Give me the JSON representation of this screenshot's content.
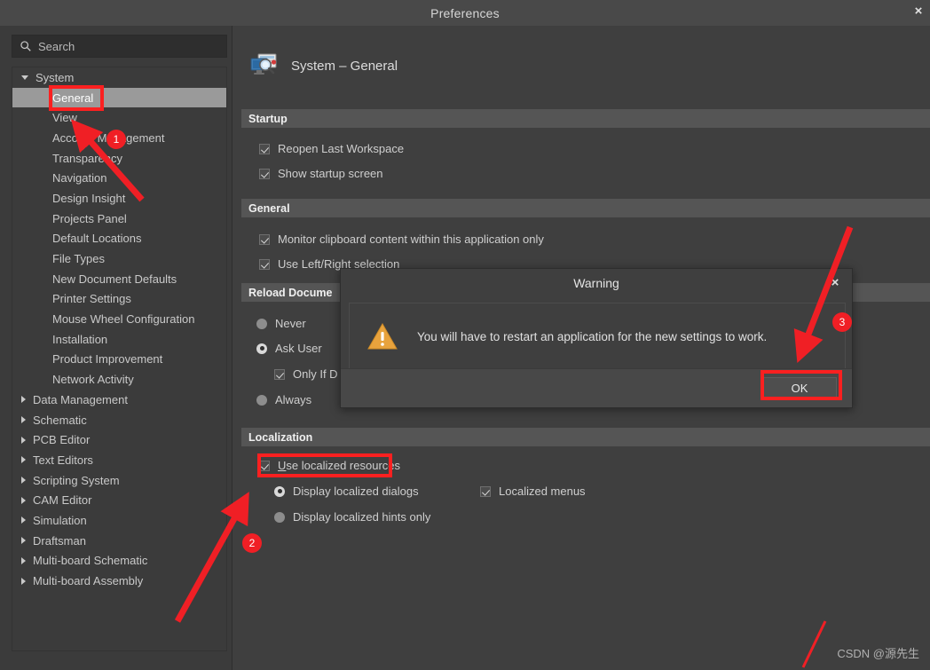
{
  "window": {
    "title": "Preferences",
    "close_label": "×"
  },
  "sidebar": {
    "search": {
      "placeholder": "Search",
      "value": "",
      "icon": "search-icon"
    },
    "tree": [
      {
        "label": "System",
        "level": "root",
        "state": "expanded",
        "selected": false
      },
      {
        "label": "General",
        "level": "child",
        "state": "leaf",
        "selected": true
      },
      {
        "label": "View",
        "level": "child",
        "state": "leaf",
        "selected": false
      },
      {
        "label": "Account Management",
        "level": "child",
        "state": "leaf",
        "selected": false
      },
      {
        "label": "Transparency",
        "level": "child",
        "state": "leaf",
        "selected": false
      },
      {
        "label": "Navigation",
        "level": "child",
        "state": "leaf",
        "selected": false
      },
      {
        "label": "Design Insight",
        "level": "child",
        "state": "leaf",
        "selected": false
      },
      {
        "label": "Projects Panel",
        "level": "child",
        "state": "leaf",
        "selected": false
      },
      {
        "label": "Default Locations",
        "level": "child",
        "state": "leaf",
        "selected": false
      },
      {
        "label": "File Types",
        "level": "child",
        "state": "leaf",
        "selected": false
      },
      {
        "label": "New Document Defaults",
        "level": "child",
        "state": "leaf",
        "selected": false
      },
      {
        "label": "Printer Settings",
        "level": "child",
        "state": "leaf",
        "selected": false
      },
      {
        "label": "Mouse Wheel Configuration",
        "level": "child",
        "state": "leaf",
        "selected": false
      },
      {
        "label": "Installation",
        "level": "child",
        "state": "leaf",
        "selected": false
      },
      {
        "label": "Product Improvement",
        "level": "child",
        "state": "leaf",
        "selected": false
      },
      {
        "label": "Network Activity",
        "level": "child",
        "state": "leaf",
        "selected": false
      },
      {
        "label": "Data Management",
        "level": "root",
        "state": "collapsed",
        "selected": false
      },
      {
        "label": "Schematic",
        "level": "root",
        "state": "collapsed",
        "selected": false
      },
      {
        "label": "PCB Editor",
        "level": "root",
        "state": "collapsed",
        "selected": false
      },
      {
        "label": "Text Editors",
        "level": "root",
        "state": "collapsed",
        "selected": false
      },
      {
        "label": "Scripting System",
        "level": "root",
        "state": "collapsed",
        "selected": false
      },
      {
        "label": "CAM Editor",
        "level": "root",
        "state": "collapsed",
        "selected": false
      },
      {
        "label": "Simulation",
        "level": "root",
        "state": "collapsed",
        "selected": false
      },
      {
        "label": "Draftsman",
        "level": "root",
        "state": "collapsed",
        "selected": false
      },
      {
        "label": "Multi-board Schematic",
        "level": "root",
        "state": "collapsed",
        "selected": false
      },
      {
        "label": "Multi-board Assembly",
        "level": "root",
        "state": "collapsed",
        "selected": false
      }
    ]
  },
  "main": {
    "page_title": "System – General",
    "page_icon": "monitor-search-icon",
    "sections": {
      "startup": {
        "header": "Startup",
        "options": [
          {
            "label": "Reopen Last Workspace",
            "type": "checkbox",
            "checked": true
          },
          {
            "label": "Show startup screen",
            "type": "checkbox",
            "checked": true
          }
        ]
      },
      "general": {
        "header": "General",
        "options": [
          {
            "label": "Monitor clipboard content within this application only",
            "type": "checkbox",
            "checked": true
          },
          {
            "label": "Use Left/Right selection",
            "type": "checkbox",
            "checked": true
          }
        ]
      },
      "reload_documents": {
        "header": "Reload Docume",
        "options": [
          {
            "label": "Never",
            "type": "radio",
            "checked": false
          },
          {
            "label": "Ask User",
            "type": "radio",
            "checked": true
          },
          {
            "label": "Only If D",
            "type": "checkbox",
            "checked": true
          },
          {
            "label": "Always",
            "type": "radio",
            "checked": false
          }
        ]
      },
      "localization": {
        "header": "Localization",
        "use_localized": {
          "label": "Use localized resources",
          "accel_char": "U",
          "rest": "se localized resources",
          "type": "checkbox",
          "checked": true
        },
        "options": [
          {
            "label": "Display localized dialogs",
            "type": "radio",
            "checked": true
          },
          {
            "label": "Display localized hints only",
            "type": "radio",
            "checked": false
          },
          {
            "label": "Localized menus",
            "type": "checkbox",
            "checked": true
          }
        ]
      }
    }
  },
  "dialog": {
    "title": "Warning",
    "close_label": "×",
    "icon": "warning-triangle-icon",
    "message": "You will have to restart an application for the new settings to work.",
    "ok_label": "OK"
  },
  "annotations": {
    "badges": [
      {
        "number": "1"
      },
      {
        "number": "2"
      },
      {
        "number": "3"
      }
    ],
    "color": "#f01f25"
  },
  "watermark": "CSDN @源先生"
}
